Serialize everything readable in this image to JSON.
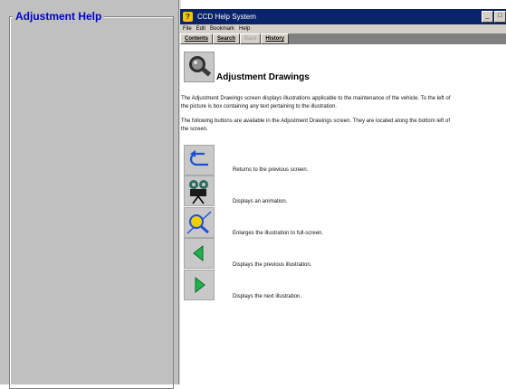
{
  "left_panel": {
    "group_title": "Adjustment Help"
  },
  "window": {
    "title": "CCD Help System",
    "controls": [
      "_",
      "□"
    ]
  },
  "menu": [
    "File",
    "Edit",
    "Bookmark",
    "Help"
  ],
  "nav": [
    {
      "label": "Contents",
      "enabled": true
    },
    {
      "label": "Search",
      "enabled": true
    },
    {
      "label": "Back",
      "enabled": false
    },
    {
      "label": "History",
      "enabled": true
    }
  ],
  "page": {
    "title": "Adjustment Drawings",
    "para1_line1": "The Adjustment Drawings screen displays illustrations applicable to the maintenance of the vehicle.  To the left of",
    "para1_line2": "the picture is box containing any text pertaining to the illustration.",
    "para2_line1": "The following buttons are available in the Adjustment Drawings screen.  They are located along the bottom left of",
    "para2_line2": "the screen."
  },
  "buttons": [
    {
      "icon": "return-arrow-icon",
      "desc": "Returns to the previous screen."
    },
    {
      "icon": "film-camera-icon",
      "desc": "Displays an animation."
    },
    {
      "icon": "magnifier-icon",
      "desc": "Enlarges the illustration to full-screen."
    },
    {
      "icon": "previous-arrow-icon",
      "desc": "Displays the previous illustration."
    },
    {
      "icon": "next-arrow-icon",
      "desc": "Displays the next illustration."
    }
  ],
  "colors": {
    "title_bar": "#0a246a",
    "group_title": "#0000cc",
    "panel": "#c0c0c0"
  }
}
